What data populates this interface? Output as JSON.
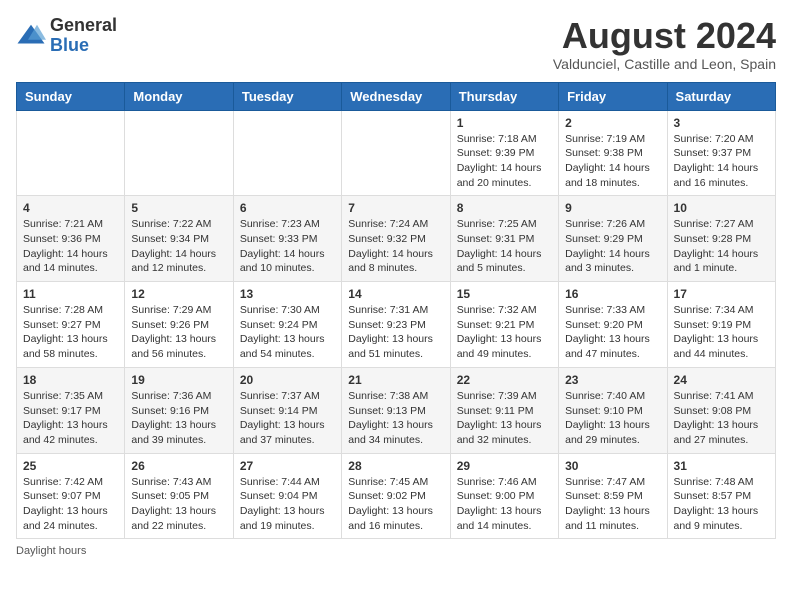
{
  "logo": {
    "general": "General",
    "blue": "Blue"
  },
  "title": "August 2024",
  "subtitle": "Valdunciel, Castille and Leon, Spain",
  "days_header": [
    "Sunday",
    "Monday",
    "Tuesday",
    "Wednesday",
    "Thursday",
    "Friday",
    "Saturday"
  ],
  "weeks": [
    [
      {
        "day": "",
        "info": ""
      },
      {
        "day": "",
        "info": ""
      },
      {
        "day": "",
        "info": ""
      },
      {
        "day": "",
        "info": ""
      },
      {
        "day": "1",
        "info": "Sunrise: 7:18 AM\nSunset: 9:39 PM\nDaylight: 14 hours and 20 minutes."
      },
      {
        "day": "2",
        "info": "Sunrise: 7:19 AM\nSunset: 9:38 PM\nDaylight: 14 hours and 18 minutes."
      },
      {
        "day": "3",
        "info": "Sunrise: 7:20 AM\nSunset: 9:37 PM\nDaylight: 14 hours and 16 minutes."
      }
    ],
    [
      {
        "day": "4",
        "info": "Sunrise: 7:21 AM\nSunset: 9:36 PM\nDaylight: 14 hours and 14 minutes."
      },
      {
        "day": "5",
        "info": "Sunrise: 7:22 AM\nSunset: 9:34 PM\nDaylight: 14 hours and 12 minutes."
      },
      {
        "day": "6",
        "info": "Sunrise: 7:23 AM\nSunset: 9:33 PM\nDaylight: 14 hours and 10 minutes."
      },
      {
        "day": "7",
        "info": "Sunrise: 7:24 AM\nSunset: 9:32 PM\nDaylight: 14 hours and 8 minutes."
      },
      {
        "day": "8",
        "info": "Sunrise: 7:25 AM\nSunset: 9:31 PM\nDaylight: 14 hours and 5 minutes."
      },
      {
        "day": "9",
        "info": "Sunrise: 7:26 AM\nSunset: 9:29 PM\nDaylight: 14 hours and 3 minutes."
      },
      {
        "day": "10",
        "info": "Sunrise: 7:27 AM\nSunset: 9:28 PM\nDaylight: 14 hours and 1 minute."
      }
    ],
    [
      {
        "day": "11",
        "info": "Sunrise: 7:28 AM\nSunset: 9:27 PM\nDaylight: 13 hours and 58 minutes."
      },
      {
        "day": "12",
        "info": "Sunrise: 7:29 AM\nSunset: 9:26 PM\nDaylight: 13 hours and 56 minutes."
      },
      {
        "day": "13",
        "info": "Sunrise: 7:30 AM\nSunset: 9:24 PM\nDaylight: 13 hours and 54 minutes."
      },
      {
        "day": "14",
        "info": "Sunrise: 7:31 AM\nSunset: 9:23 PM\nDaylight: 13 hours and 51 minutes."
      },
      {
        "day": "15",
        "info": "Sunrise: 7:32 AM\nSunset: 9:21 PM\nDaylight: 13 hours and 49 minutes."
      },
      {
        "day": "16",
        "info": "Sunrise: 7:33 AM\nSunset: 9:20 PM\nDaylight: 13 hours and 47 minutes."
      },
      {
        "day": "17",
        "info": "Sunrise: 7:34 AM\nSunset: 9:19 PM\nDaylight: 13 hours and 44 minutes."
      }
    ],
    [
      {
        "day": "18",
        "info": "Sunrise: 7:35 AM\nSunset: 9:17 PM\nDaylight: 13 hours and 42 minutes."
      },
      {
        "day": "19",
        "info": "Sunrise: 7:36 AM\nSunset: 9:16 PM\nDaylight: 13 hours and 39 minutes."
      },
      {
        "day": "20",
        "info": "Sunrise: 7:37 AM\nSunset: 9:14 PM\nDaylight: 13 hours and 37 minutes."
      },
      {
        "day": "21",
        "info": "Sunrise: 7:38 AM\nSunset: 9:13 PM\nDaylight: 13 hours and 34 minutes."
      },
      {
        "day": "22",
        "info": "Sunrise: 7:39 AM\nSunset: 9:11 PM\nDaylight: 13 hours and 32 minutes."
      },
      {
        "day": "23",
        "info": "Sunrise: 7:40 AM\nSunset: 9:10 PM\nDaylight: 13 hours and 29 minutes."
      },
      {
        "day": "24",
        "info": "Sunrise: 7:41 AM\nSunset: 9:08 PM\nDaylight: 13 hours and 27 minutes."
      }
    ],
    [
      {
        "day": "25",
        "info": "Sunrise: 7:42 AM\nSunset: 9:07 PM\nDaylight: 13 hours and 24 minutes."
      },
      {
        "day": "26",
        "info": "Sunrise: 7:43 AM\nSunset: 9:05 PM\nDaylight: 13 hours and 22 minutes."
      },
      {
        "day": "27",
        "info": "Sunrise: 7:44 AM\nSunset: 9:04 PM\nDaylight: 13 hours and 19 minutes."
      },
      {
        "day": "28",
        "info": "Sunrise: 7:45 AM\nSunset: 9:02 PM\nDaylight: 13 hours and 16 minutes."
      },
      {
        "day": "29",
        "info": "Sunrise: 7:46 AM\nSunset: 9:00 PM\nDaylight: 13 hours and 14 minutes."
      },
      {
        "day": "30",
        "info": "Sunrise: 7:47 AM\nSunset: 8:59 PM\nDaylight: 13 hours and 11 minutes."
      },
      {
        "day": "31",
        "info": "Sunrise: 7:48 AM\nSunset: 8:57 PM\nDaylight: 13 hours and 9 minutes."
      }
    ]
  ],
  "footer": "Daylight hours"
}
